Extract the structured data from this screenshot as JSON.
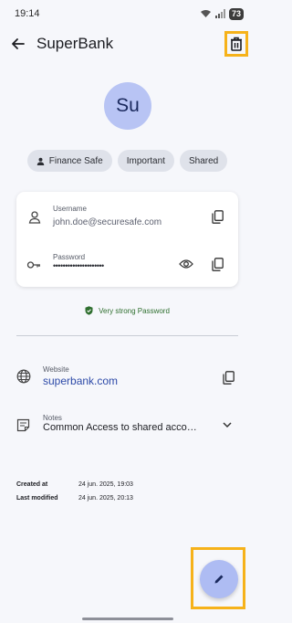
{
  "status_bar": {
    "time": "19:14",
    "battery": "73"
  },
  "app_bar": {
    "title": "SuperBank",
    "back_icon": "arrow-left-icon",
    "delete_icon": "trash-icon"
  },
  "avatar": {
    "initials": "Su",
    "color": "#b8c4f4"
  },
  "tags": [
    {
      "label": "Finance Safe",
      "icon": "person-icon"
    },
    {
      "label": "Important"
    },
    {
      "label": "Shared"
    }
  ],
  "credentials": {
    "username_label": "Username",
    "username_value": "john.doe@securesafe.com",
    "password_label": "Password",
    "password_value": "•••••••••••••••••••••",
    "username_icon": "person-outline-icon",
    "password_icon": "key-icon"
  },
  "strength": {
    "text": "Very strong Password",
    "color": "#2f6f2f"
  },
  "website": {
    "label": "Website",
    "value": "superbank.com",
    "icon": "globe-icon"
  },
  "notes": {
    "label": "Notes",
    "value": "Common Access to shared acco…",
    "icon": "note-icon"
  },
  "meta": {
    "created_label": "Created at",
    "created_value": "24 jun. 2025, 19:03",
    "modified_label": "Last modified",
    "modified_value": "24 jun. 2025, 20:13"
  },
  "fab": {
    "icon": "pencil-icon",
    "color": "#aebcf3"
  },
  "highlight_color": "#f6b21a"
}
